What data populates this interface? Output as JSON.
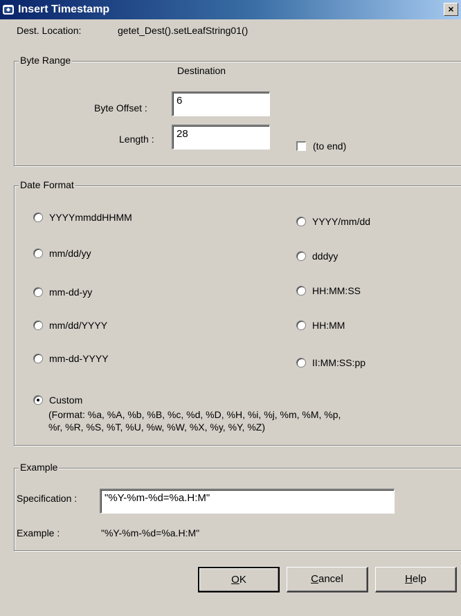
{
  "window": {
    "title": "Insert Timestamp",
    "close_glyph": "×"
  },
  "dest_location": {
    "label": "Dest. Location:",
    "value": "getet_Dest().setLeafString01()"
  },
  "byte_range": {
    "legend": "Byte Range",
    "column_header": "Destination",
    "byte_offset_label": "Byte Offset  :",
    "byte_offset_value": "6",
    "length_label": "Length  :",
    "length_value": "28",
    "to_end_label": "(to end)",
    "to_end_checked": false
  },
  "date_format": {
    "legend": "Date Format",
    "options": [
      {
        "label": "YYYYmmddHHMM",
        "checked": false
      },
      {
        "label": "YYYY/mm/dd",
        "checked": false
      },
      {
        "label": "mm/dd/yy",
        "checked": false
      },
      {
        "label": "dddyy",
        "checked": false
      },
      {
        "label": "mm-dd-yy",
        "checked": false
      },
      {
        "label": "HH:MM:SS",
        "checked": false
      },
      {
        "label": "mm/dd/YYYY",
        "checked": false
      },
      {
        "label": "HH:MM",
        "checked": false
      },
      {
        "label": "mm-dd-YYYY",
        "checked": false
      },
      {
        "label": "II:MM:SS:pp",
        "checked": false
      },
      {
        "label": "Custom",
        "checked": true
      }
    ],
    "custom_help_line1": "(Format: %a, %A, %b, %B, %c, %d, %D, %H, %i, %j, %m, %M, %p,",
    "custom_help_line2": "%r, %R, %S, %T, %U, %w, %W, %X, %y, %Y, %Z)"
  },
  "example": {
    "legend": "Example",
    "specification_label": "Specification :",
    "specification_value": "\"%Y-%m-%d=%a.H:M\"",
    "example_label": "Example :",
    "example_value": "\"%Y-%m-%d=%a.H:M\""
  },
  "buttons": {
    "ok": {
      "mnemonic": "O",
      "rest": "K"
    },
    "cancel": {
      "mnemonic": "C",
      "rest": "ancel"
    },
    "help": {
      "mnemonic": "H",
      "rest": "elp"
    }
  },
  "colors": {
    "face": "#d4d0c8",
    "title_start": "#0a246a",
    "title_end": "#a6caf0"
  }
}
